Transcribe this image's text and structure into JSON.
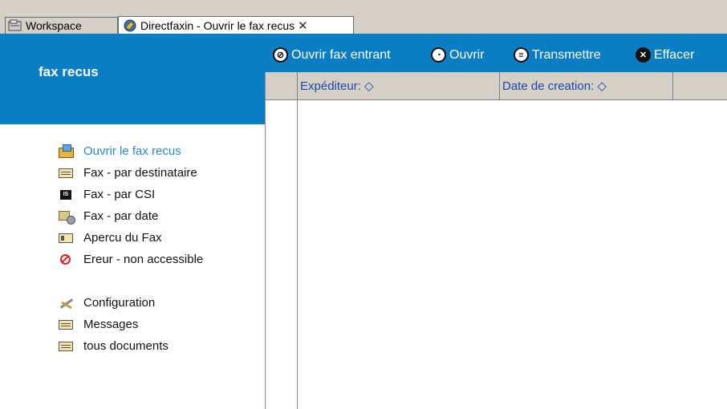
{
  "tabs": [
    {
      "label": "Workspace",
      "icon": "workspace-icon"
    },
    {
      "label": "Directfaxin - Ouvrir le fax recus",
      "icon": "directfax-icon",
      "close": "✕"
    }
  ],
  "sidebar": {
    "title": "fax recus",
    "items": [
      {
        "label": "Ouvrir le fax recus",
        "icon": "open-envelope-icon",
        "active": true
      },
      {
        "label": "Fax - par destinataire",
        "icon": "list-icon"
      },
      {
        "label": "Fax - par CSI",
        "icon": "csi-icon"
      },
      {
        "label": "Fax - par date",
        "icon": "date-icon"
      },
      {
        "label": "Apercu du Fax",
        "icon": "preview-icon"
      },
      {
        "label": "Ereur - non accessible",
        "icon": "error-icon"
      },
      {
        "label": "Configuration",
        "icon": "configuration-icon"
      },
      {
        "label": "Messages",
        "icon": "list-icon"
      },
      {
        "label": "tous documents",
        "icon": "list-icon"
      }
    ]
  },
  "toolbar": {
    "buttons": [
      {
        "label": "Ouvrir fax entrant",
        "icon": "open-incoming-icon"
      },
      {
        "label": "Ouvrir",
        "icon": "open-icon"
      },
      {
        "label": "Transmettre",
        "icon": "forward-icon"
      },
      {
        "label": "Effacer",
        "icon": "delete-icon"
      }
    ]
  },
  "grid": {
    "columns": [
      {
        "label": ""
      },
      {
        "label": "Expéditeur: ◇"
      },
      {
        "label": "Date de creation: ◇"
      },
      {
        "label": ""
      }
    ],
    "rows": []
  },
  "colors": {
    "header_blue": "#0a7dc4",
    "column_header_text": "#1c49a8",
    "active_link": "#2f86d0"
  }
}
